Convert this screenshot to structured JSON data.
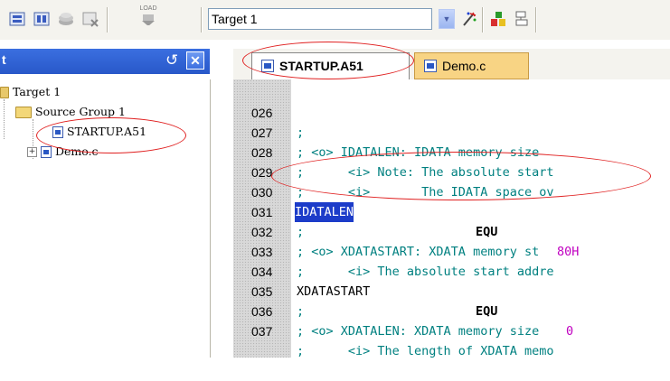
{
  "toolbar": {
    "target_value": "Target 1",
    "load_label": "LOAD",
    "buttons": [
      "build-icon",
      "rebuild-icon",
      "batch-build-icon",
      "stop-build-icon",
      "download-icon",
      "wand-icon",
      "components-icon",
      "manage-icon"
    ]
  },
  "project_panel": {
    "title": "t",
    "tree": {
      "target": "Target 1",
      "group": "Source Group 1",
      "files": [
        "STARTUP.A51",
        "Demo.c"
      ]
    }
  },
  "tabs": [
    {
      "label": "STARTUP.A51",
      "active": true
    },
    {
      "label": "Demo.c",
      "active": false
    }
  ],
  "editor": {
    "lines": [
      {
        "num": "026",
        "code": ";"
      },
      {
        "num": "027",
        "code": "; <o> IDATALEN: IDATA memory size"
      },
      {
        "num": "028",
        "code": ";      <i> Note: The absolute start"
      },
      {
        "num": "029",
        "code": ";      <i>       The IDATA space ov"
      },
      {
        "num": "030",
        "label": "IDATALEN",
        "kw": "EQU",
        "val": "80H"
      },
      {
        "num": "031",
        "code": ";"
      },
      {
        "num": "032",
        "code": "; <o> XDATASTART: XDATA memory st"
      },
      {
        "num": "033",
        "code": ";      <i> The absolute start addre"
      },
      {
        "num": "034",
        "label": "XDATASTART",
        "kw": "EQU",
        "val": "0"
      },
      {
        "num": "035",
        "code": ";"
      },
      {
        "num": "036",
        "code": "; <o> XDATALEN: XDATA memory size"
      },
      {
        "num": "037",
        "code": ";      <i> The length of XDATA memo"
      }
    ]
  },
  "colors": {
    "comment": "#008080",
    "value": "#c000c0",
    "selection": "#1c3cc9",
    "annotation": "#e02020"
  }
}
